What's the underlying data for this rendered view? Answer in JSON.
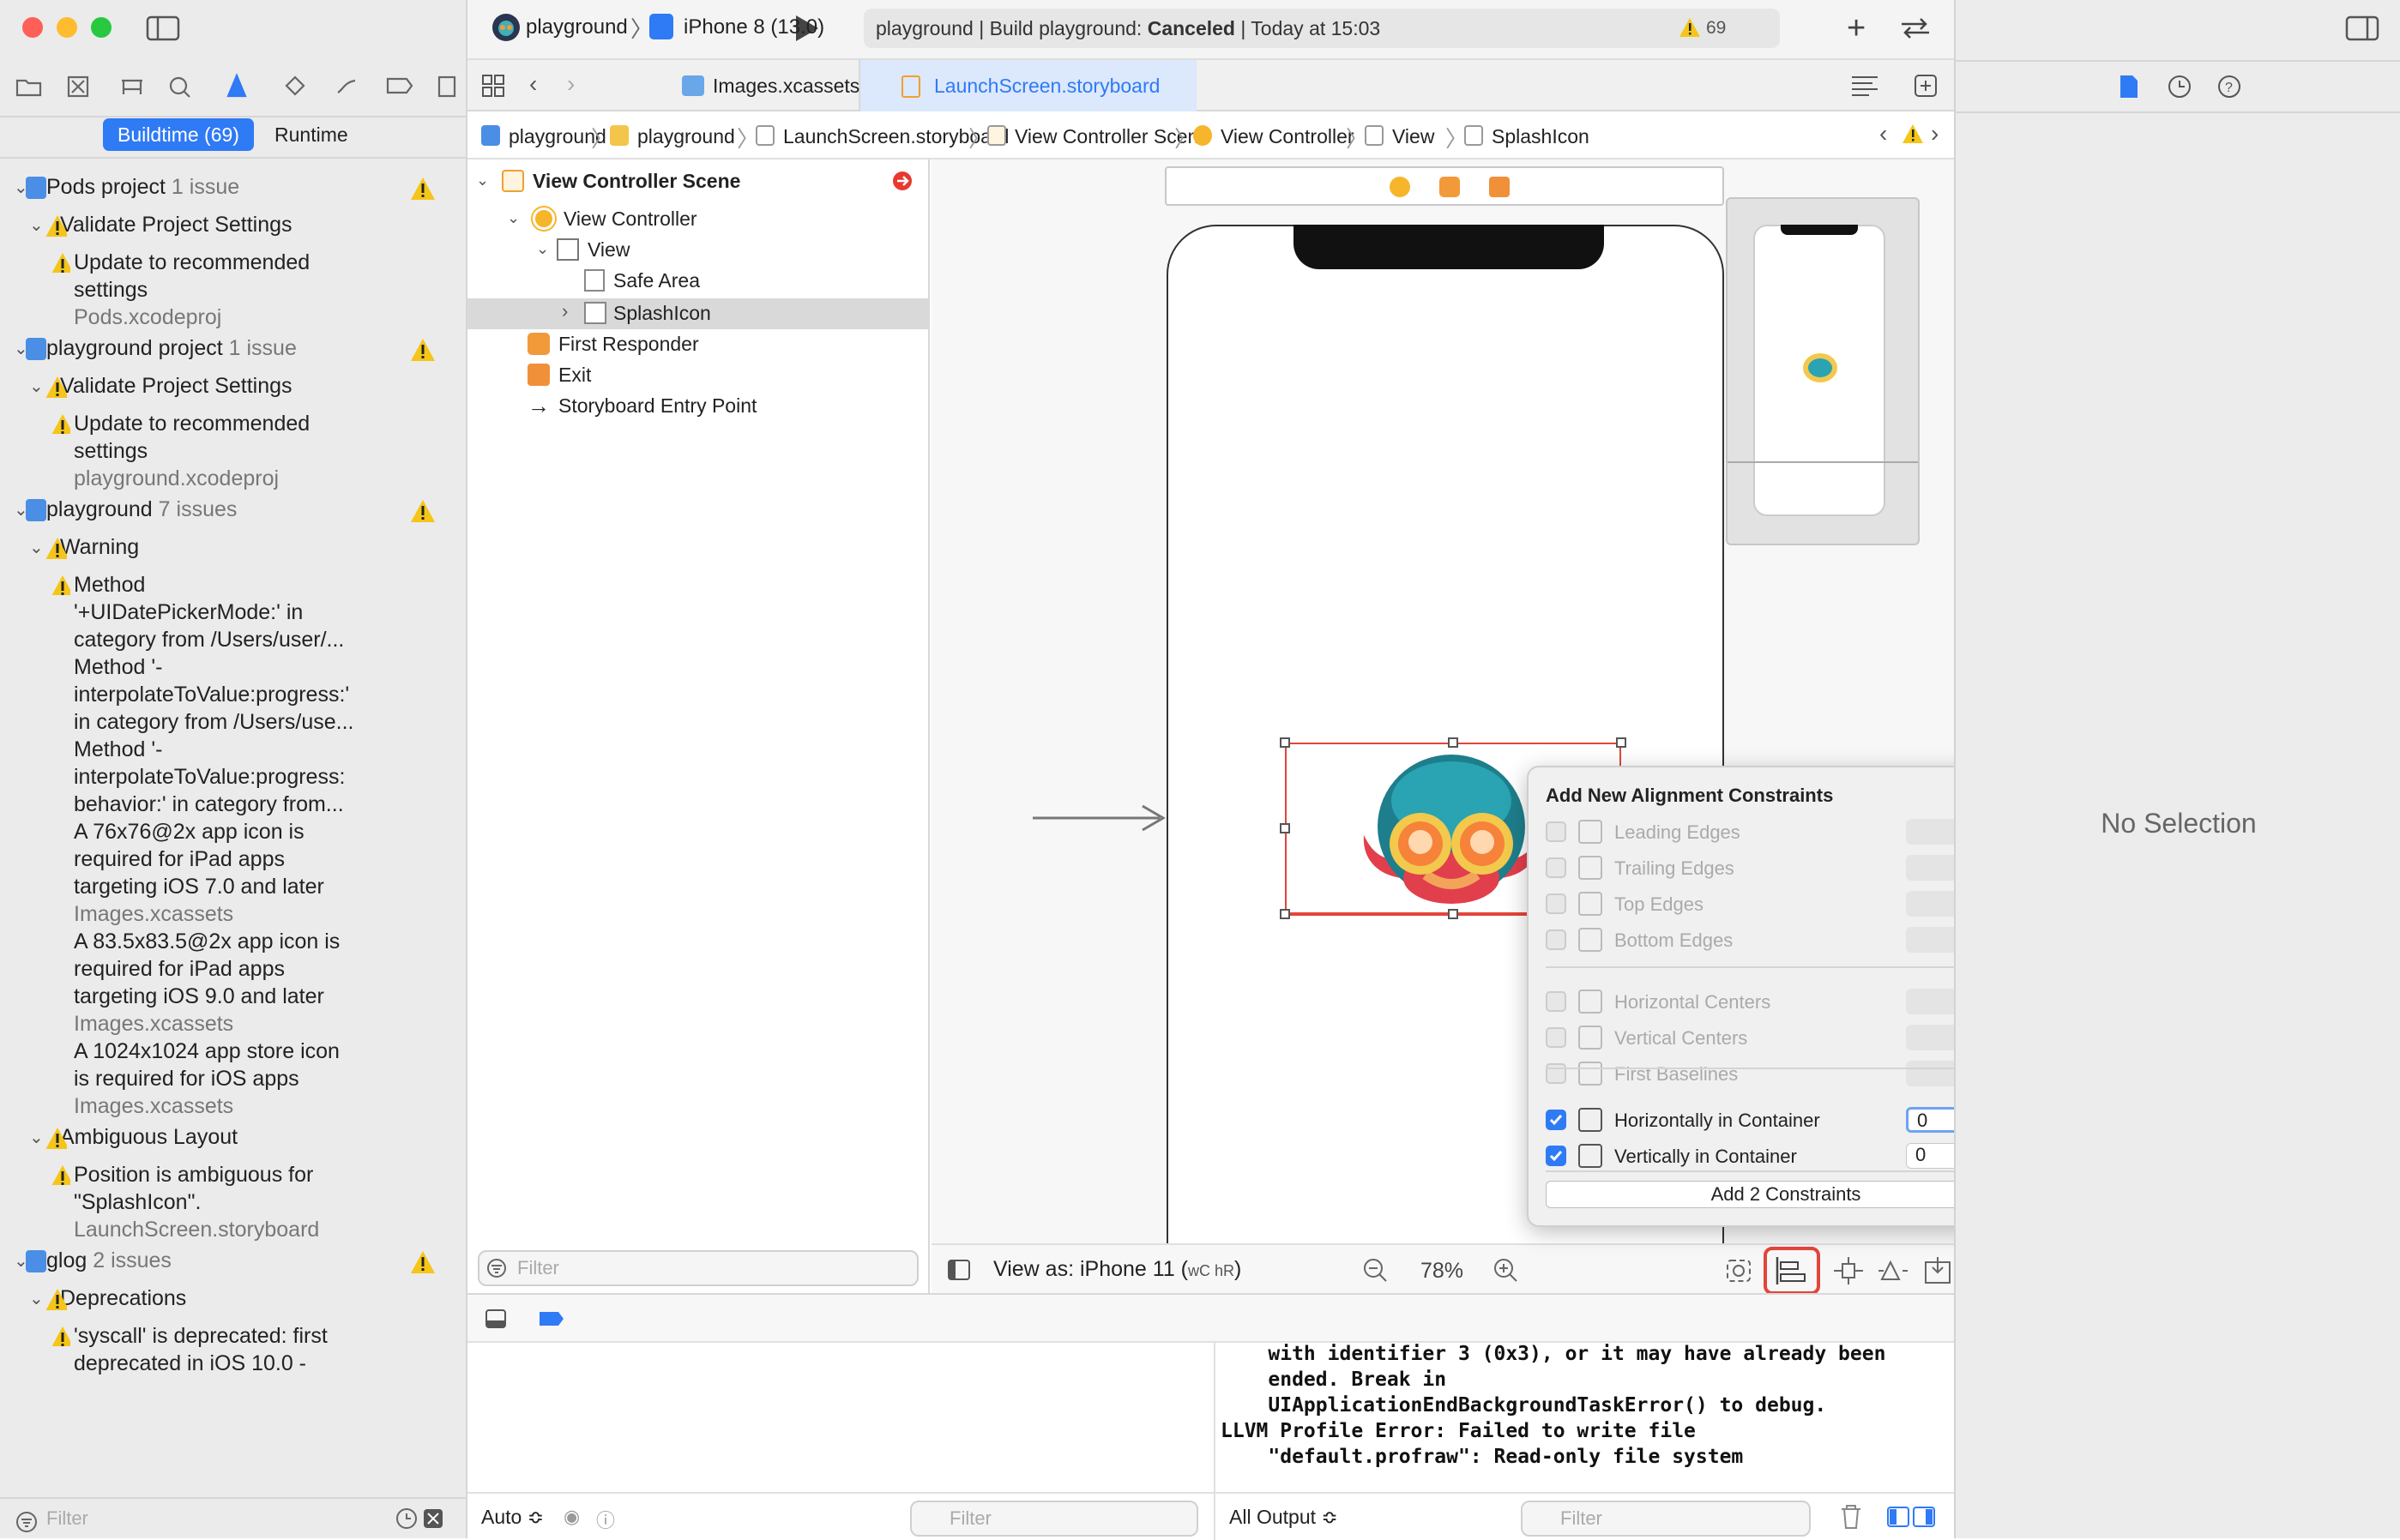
{
  "navigator": {
    "tabs": {
      "buildtime": "Buildtime (69)",
      "runtime": "Runtime"
    },
    "issues": [
      {
        "text": "Pods project",
        "suffix": "1 issue",
        "level": 0
      },
      {
        "text": "Validate Project Settings",
        "level": 1
      },
      {
        "text": "Update to recommended",
        "level": 2
      },
      {
        "text": "settings",
        "level": 2
      },
      {
        "text": "Pods.xcodeproj",
        "level": 2
      },
      {
        "text": "playground project",
        "suffix": "1 issue",
        "level": 0
      },
      {
        "text": "Validate Project Settings",
        "level": 1
      },
      {
        "text": "Update to recommended",
        "level": 2
      },
      {
        "text": "settings",
        "level": 2
      },
      {
        "text": "playground.xcodeproj",
        "level": 2
      },
      {
        "text": "playground",
        "suffix": "7 issues",
        "level": 0
      },
      {
        "text": "Warning",
        "level": 1
      },
      {
        "text": "Method",
        "level": 2
      },
      {
        "text": "'+UIDatePickerMode:' in",
        "level": 2
      },
      {
        "text": "category from /Users/user/...",
        "level": 2
      },
      {
        "text": "Method '-",
        "level": 2
      },
      {
        "text": "interpolateToValue:progress:'",
        "level": 2
      },
      {
        "text": "in category from /Users/use...",
        "level": 2
      },
      {
        "text": "Method '-",
        "level": 2
      },
      {
        "text": "interpolateToValue:progress:",
        "level": 2
      },
      {
        "text": "behavior:' in category from...",
        "level": 2
      },
      {
        "text": "A 76x76@2x app icon is",
        "level": 2
      },
      {
        "text": "required for iPad apps",
        "level": 2
      },
      {
        "text": "targeting iOS 7.0 and later",
        "level": 2
      },
      {
        "text": "Images.xcassets",
        "level": 2
      },
      {
        "text": "A 83.5x83.5@2x app icon is",
        "level": 2
      },
      {
        "text": "required for iPad apps",
        "level": 2
      },
      {
        "text": "targeting iOS 9.0 and later",
        "level": 2
      },
      {
        "text": "Images.xcassets",
        "level": 2
      },
      {
        "text": "A 1024x1024 app store icon",
        "level": 2
      },
      {
        "text": "is required for iOS apps",
        "level": 2
      },
      {
        "text": "Images.xcassets",
        "level": 2
      },
      {
        "text": "Ambiguous Layout",
        "level": 1
      },
      {
        "text": "Position is ambiguous for",
        "level": 2
      },
      {
        "text": "\"SplashIcon\".",
        "level": 2
      },
      {
        "text": "LaunchScreen.storyboard",
        "level": 2
      },
      {
        "text": "glog",
        "suffix": "2 issues",
        "level": 0
      },
      {
        "text": "Deprecations",
        "level": 1
      },
      {
        "text": "'syscall' is deprecated: first",
        "level": 2
      },
      {
        "text": "deprecated in iOS 10.0 -",
        "level": 2
      }
    ],
    "filter_placeholder": "Filter"
  },
  "toolbar": {
    "scheme": "playground",
    "device": "iPhone 8 (13.0)",
    "activity": "playground | Build playground: ",
    "activity_status": "Canceled",
    "activity_time": " | Today at 15:03",
    "warning_count": "69"
  },
  "tabs": [
    "Images.xcassets",
    "LaunchScreen.storyboard"
  ],
  "breadcrumb": [
    "playground",
    "playground",
    "LaunchScreen.storyboard",
    "View Controller Scene",
    "View Controller",
    "View",
    "SplashIcon"
  ],
  "outline": {
    "scene": "View Controller Scene",
    "items": [
      "View Controller",
      "View",
      "Safe Area",
      "SplashIcon",
      "First Responder",
      "Exit",
      "Storyboard Entry Point"
    ],
    "filter_placeholder": "Filter"
  },
  "canvas": {
    "view_as": "View as: iPhone 11 (",
    "size_class": "wC hR",
    "view_as_close": ")",
    "zoom": "78%"
  },
  "popover": {
    "title": "Add New Alignment Constraints",
    "rows": [
      {
        "label": "Leading Edges",
        "checked": false,
        "value": ""
      },
      {
        "label": "Trailing Edges",
        "checked": false,
        "value": ""
      },
      {
        "label": "Top Edges",
        "checked": false,
        "value": ""
      },
      {
        "label": "Bottom Edges",
        "checked": false,
        "value": ""
      },
      {
        "label": "Horizontal Centers",
        "checked": false,
        "value": ""
      },
      {
        "label": "Vertical Centers",
        "checked": false,
        "value": ""
      },
      {
        "label": "First Baselines",
        "checked": false,
        "value": ""
      },
      {
        "label": "Horizontally in Container",
        "checked": true,
        "value": "0"
      },
      {
        "label": "Vertically in Container",
        "checked": true,
        "value": "0"
      }
    ],
    "add_button": "Add 2 Constraints"
  },
  "inspector": {
    "empty": "No Selection"
  },
  "debug": {
    "console_lines": [
      "    with identifier 3 (0x3), or it may have already been",
      "    ended. Break in",
      "    UIApplicationEndBackgroundTaskError() to debug.",
      "LLVM Profile Error: Failed to write file",
      "    \"default.profraw\": Read-only file system"
    ],
    "auto_label": "Auto ≎",
    "output_label": "All Output ≎",
    "filter_placeholder": "Filter"
  },
  "colors": {
    "accent": "#2f7af5",
    "warning": "#f5c518",
    "error": "#e8382f",
    "selection": "#d9d9d9"
  }
}
